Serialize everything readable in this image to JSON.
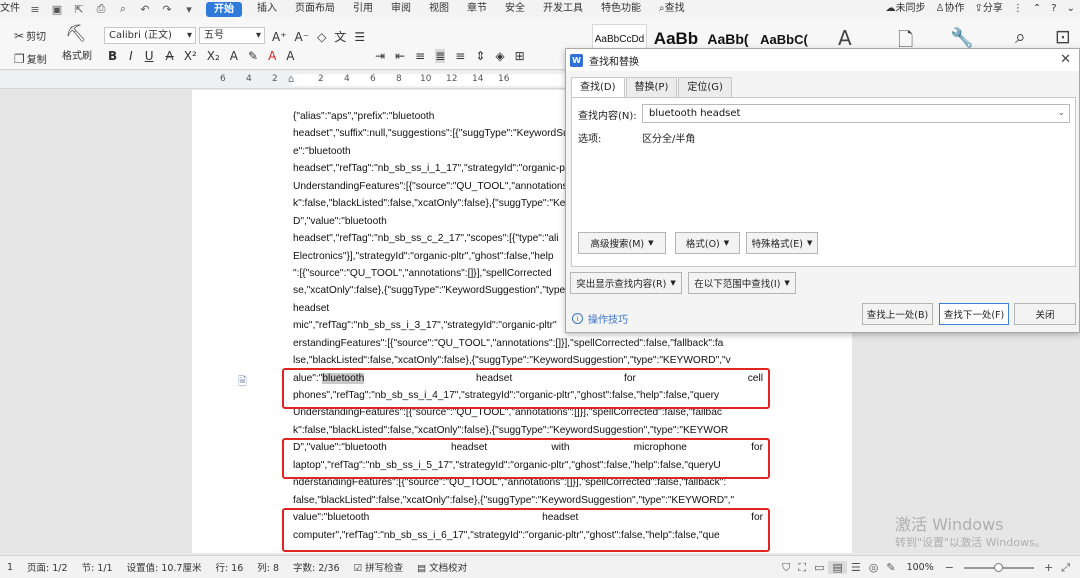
{
  "menubar": {
    "file": "文件",
    "start": "开始",
    "items": [
      "插入",
      "页面布局",
      "引用",
      "审阅",
      "视图",
      "章节",
      "安全",
      "开发工具",
      "特色功能"
    ],
    "search": "查找",
    "sync": "未同步",
    "collab": "协作",
    "share": "分享"
  },
  "ribbon": {
    "cut": "剪切",
    "copy": "复制",
    "format_painter": "格式刷",
    "font": "Calibri (正文)",
    "size": "五号",
    "styles": [
      "AaBbCcDd",
      "AaBb",
      "AaBb(",
      "AaBbC("
    ]
  },
  "ruler": {
    "numbers": [
      "6",
      "4",
      "2",
      "2",
      "4",
      "6",
      "8",
      "10",
      "12",
      "14",
      "16"
    ]
  },
  "document": {
    "lines": [
      {
        "t": "{\"alias\":\"aps\",\"prefix\":\"bluetooth"
      },
      {
        "t": "headset\",\"suffix\":null,\"suggestions\":[{\"suggType\":\"KeywordSuggestion\""
      },
      {
        "t": "e\":\"bluetooth"
      },
      {
        "t": "headset\",\"refTag\":\"nb_sb_ss_i_1_17\",\"strategyId\":\"organic-pltr\""
      },
      {
        "t": "UnderstandingFeatures\":[{\"source\":\"QU_TOOL\",\"annotations\":[]}]"
      },
      {
        "t": "k\":false,\"blackListed\":false,\"xcatOnly\":false},{\"suggType\":\"Key"
      },
      {
        "t": "D\",\"value\":\"bluetooth"
      },
      {
        "t": "headset\",\"refTag\":\"nb_sb_ss_c_2_17\",\"scopes\":[{\"type\":\"ali"
      },
      {
        "t": "Electronics\"}],\"strategyId\":\"organic-pltr\",\"ghost\":false,\"help"
      },
      {
        "t": "\":[{\"source\":\"QU_TOOL\",\"annotations\":[]}],\"spellCorrected"
      },
      {
        "t": "se,\"xcatOnly\":false},{\"suggType\":\"KeywordSuggestion\",\"type\""
      },
      {
        "t": "headset"
      },
      {
        "t": "mic\",\"refTag\":\"nb_sb_ss_i_3_17\",\"strategyId\":\"organic-pltr\""
      },
      {
        "t": "erstandingFeatures\":[{\"source\":\"QU_TOOL\",\"annotations\":[]}],\"spellCorrected\":false,\"fallback\":fa"
      },
      {
        "t": "lse,\"blackListed\":false,\"xcatOnly\":false},{\"suggType\":\"KeywordSuggestion\",\"type\":\"KEYWORD\",\"v"
      },
      {
        "w": [
          "alue\":\"bluetooth",
          "headset",
          "for",
          "cell"
        ]
      },
      {
        "t": "phones\",\"refTag\":\"nb_sb_ss_i_4_17\",\"strategyId\":\"organic-pltr\",\"ghost\":false,\"help\":false,\"query"
      },
      {
        "t": "UnderstandingFeatures\":[{\"source\":\"QU_TOOL\",\"annotations\":[]}],\"spellCorrected\":false,\"fallbac"
      },
      {
        "t": "k\":false,\"blackListed\":false,\"xcatOnly\":false},{\"suggType\":\"KeywordSuggestion\",\"type\":\"KEYWOR"
      },
      {
        "w": [
          "D\",\"value\":\"bluetooth",
          "headset",
          "with",
          "microphone",
          "for"
        ]
      },
      {
        "t": "laptop\",\"refTag\":\"nb_sb_ss_i_5_17\",\"strategyId\":\"organic-pltr\",\"ghost\":false,\"help\":false,\"queryU"
      },
      {
        "t": "nderstandingFeatures\":[{\"source\":\"QU_TOOL\",\"annotations\":[]}],\"spellCorrected\":false,\"fallback\":"
      },
      {
        "t": "false,\"blackListed\":false,\"xcatOnly\":false},{\"suggType\":\"KeywordSuggestion\",\"type\":\"KEYWORD\",\""
      },
      {
        "w": [
          "value\":\"bluetooth",
          "headset",
          "for"
        ]
      },
      {
        "t": "computer\",\"refTag\":\"nb_sb_ss_i_6_17\",\"strategyId\":\"organic-pltr\",\"ghost\":false,\"help\":false,\"que"
      }
    ]
  },
  "dialog": {
    "title": "查找和替换",
    "tabs": [
      "查找(D)",
      "替换(P)",
      "定位(G)"
    ],
    "find_label": "查找内容(N):",
    "find_value": "bluetooth headset",
    "options_label": "选项:",
    "options_value": "区分全/半角",
    "advanced": "高级搜索(M)",
    "format": "格式(O)",
    "special": "特殊格式(E)",
    "highlight": "突出显示查找内容(R)",
    "within": "在以下范围中查找(I)",
    "tips": "操作技巧",
    "find_prev": "查找上一处(B)",
    "find_next": "查找下一处(F)",
    "close": "关闭"
  },
  "watermark": {
    "line1": "激活 Windows",
    "line2": "转到\"设置\"以激活 Windows。"
  },
  "statusbar": {
    "page_num": "1",
    "page": "页面: 1/2",
    "section": "节: 1/1",
    "setting": "设置值: 10.7厘米",
    "row": "行: 16",
    "col": "列: 8",
    "words": "字数: 2/36",
    "spell": "拼写检查",
    "proof": "文档校对",
    "zoom": "100%",
    "zoom_level": 0.5
  }
}
